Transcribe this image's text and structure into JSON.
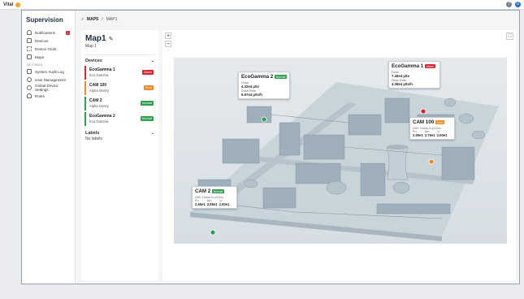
{
  "topbar": {
    "brand": "Vital",
    "help_label": "?",
    "user_label": "U"
  },
  "sidebar": {
    "title": "Supervision",
    "items": [
      {
        "label": "Notifications",
        "badge": "1"
      },
      {
        "label": "Devices"
      },
      {
        "label": "Device Grids"
      },
      {
        "label": "Maps"
      }
    ],
    "settings_header": "SETTINGS",
    "settings_items": [
      {
        "label": "System Audit Log"
      },
      {
        "label": "User Management"
      },
      {
        "label": "Global Device Settings"
      },
      {
        "label": "Roles"
      }
    ]
  },
  "breadcrumb": {
    "sep1": ">",
    "maps": "MAPS",
    "sep2": "/",
    "current": "MAP1"
  },
  "panel": {
    "title": "Map1",
    "subtitle": "Map 1",
    "devices_header": "Devices",
    "devices": [
      {
        "name": "EcoGamma 1",
        "type": "Eco Gamma",
        "status": "Alarm",
        "color": "#d9232d"
      },
      {
        "name": "CAM 100",
        "type": "Alpha Sentry",
        "status": "Error",
        "color": "#f08a24"
      },
      {
        "name": "CAM 2",
        "type": "Alpha Sentry",
        "status": "Normal",
        "color": "#2e9e4f"
      },
      {
        "name": "EcoGamma 2",
        "type": "Eco Gamma",
        "status": "Normal",
        "color": "#2e9e4f"
      }
    ],
    "labels_header": "Labels",
    "labels_empty": "No labels"
  },
  "map": {
    "zoom_in": "+",
    "zoom_out": "−",
    "fullscreen": "⛶",
    "popups": {
      "eco2": {
        "name": "EcoGamma 2",
        "status": "Normal",
        "label1": "Dose",
        "value1": "4.32e4 µSv",
        "label2": "Dose Rate",
        "value2": "5.67e4 µSv/h"
      },
      "eco1": {
        "name": "EcoGamma 1",
        "status": "Alarm",
        "label1": "Dose",
        "value1": "7.46e4 µSv",
        "label2": "Dose Rate",
        "value2": "4.38e4 µSv/h"
      },
      "cam100": {
        "name": "CAM 100",
        "status": "Error",
        "label1": "DAC Hours in µCi/cc",
        "c1": "Pu",
        "c2": "Am",
        "c3": "U",
        "v1": "2.50e1",
        "v2": "2.75e1",
        "v3": "2.00e1"
      },
      "cam2": {
        "name": "CAM 2",
        "status": "Normal",
        "label1": "DAC Hours in µCi/cc",
        "c1": "Pu",
        "c2": "Am",
        "c3": "U",
        "v1": "2.60e1",
        "v2": "2.85e1",
        "v3": "2.60e1"
      }
    }
  },
  "colors": {
    "alarm": "#d9232d",
    "error": "#f08a24",
    "normal": "#2e9e4f",
    "accent": "#1e6bd6"
  }
}
